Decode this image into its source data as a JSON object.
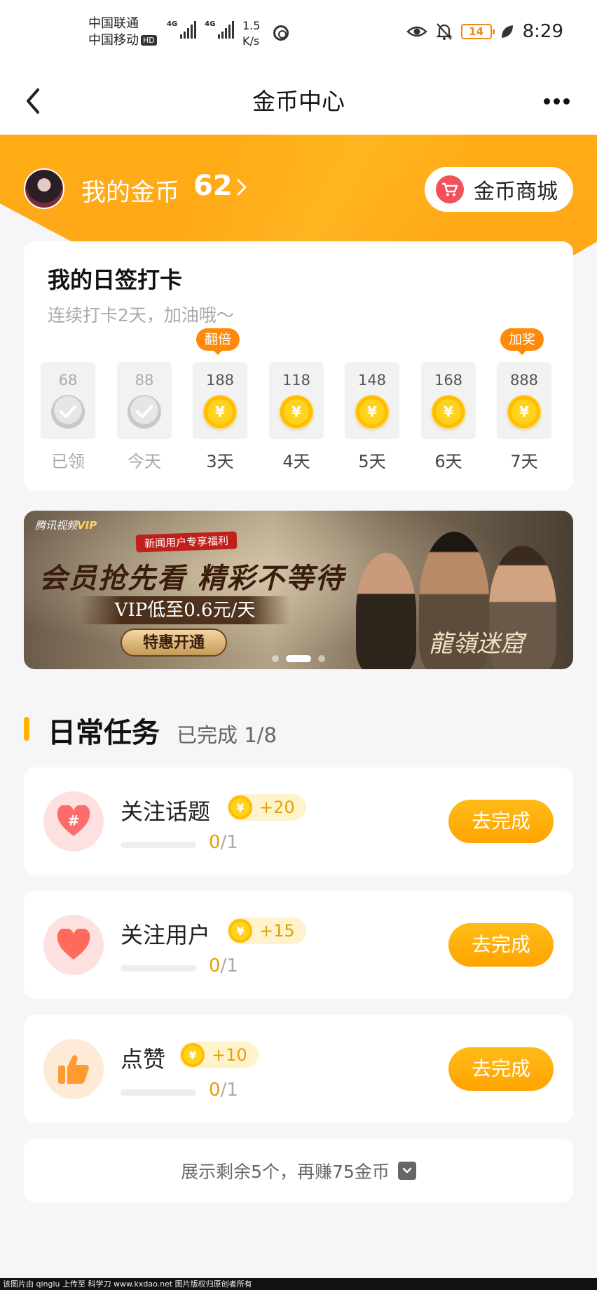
{
  "status_bar": {
    "carrier_1": "中国联通",
    "carrier_2": "中国移动",
    "hd_badge": "HD",
    "network_1": "4G",
    "network_2": "4G",
    "speed_value": "1.5",
    "speed_unit": "K/s",
    "battery": "14",
    "time": "8:29"
  },
  "nav": {
    "title": "金币中心"
  },
  "header": {
    "coins_label": "我的金币",
    "coins_value": "62",
    "mall_label": "金币商城"
  },
  "sign_in": {
    "title": "我的日签打卡",
    "subtitle": "连续打卡2天，加油哦～",
    "badges": {
      "double": "翻倍",
      "bonus": "加奖"
    },
    "days": [
      {
        "amount": "68",
        "label": "已领",
        "state": "claimed"
      },
      {
        "amount": "88",
        "label": "今天",
        "state": "claimed"
      },
      {
        "amount": "188",
        "label": "3天",
        "state": "pending"
      },
      {
        "amount": "118",
        "label": "4天",
        "state": "pending"
      },
      {
        "amount": "148",
        "label": "5天",
        "state": "pending"
      },
      {
        "amount": "168",
        "label": "6天",
        "state": "pending"
      },
      {
        "amount": "888",
        "label": "7天",
        "state": "pending"
      }
    ]
  },
  "banner": {
    "logo": "腾讯视频",
    "logo_vip": "VIP",
    "tag": "新闻用户专享福利",
    "title": "会员抢先看 精彩不等待",
    "price": "VIP低至0.6元/天",
    "cta": "特惠开通",
    "film_title": "龍嶺迷窟",
    "active_slide": 1,
    "slide_count": 3
  },
  "tasks": {
    "title": "日常任务",
    "progress": "已完成 1/8",
    "items": [
      {
        "name": "关注话题",
        "reward": "+20",
        "done": "0",
        "total": "/1",
        "button": "去完成"
      },
      {
        "name": "关注用户",
        "reward": "+15",
        "done": "0",
        "total": "/1",
        "button": "去完成"
      },
      {
        "name": "点赞",
        "reward": "+10",
        "done": "0",
        "total": "/1",
        "button": "去完成"
      }
    ],
    "more_label": "展示剩余5个，再赚75金币"
  },
  "coin_symbol": "¥",
  "footer_watermark": "该图片由 qinglu 上传至 科学刀 www.kxdao.net 图片版权归原创者所有",
  "colors": {
    "accent": "#ffa31a",
    "coin": "#ffd21e",
    "button": "#ffa400",
    "cart": "#f2505a"
  }
}
